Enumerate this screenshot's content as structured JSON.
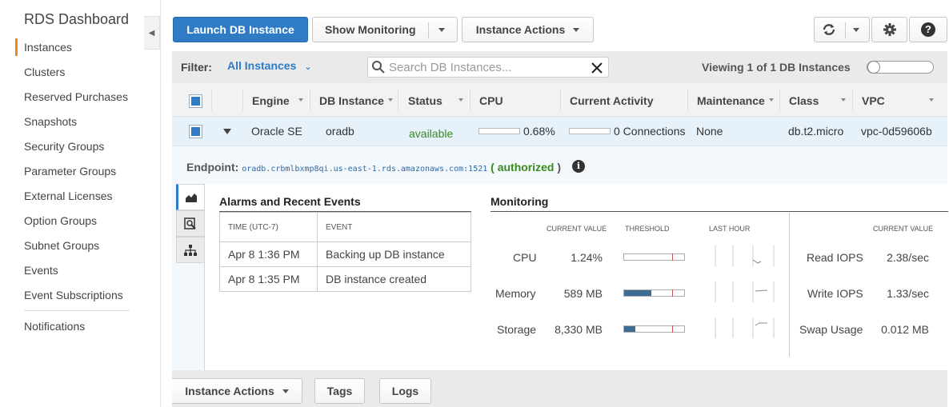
{
  "sidebar": {
    "title": "RDS Dashboard",
    "items": [
      {
        "label": "Instances"
      },
      {
        "label": "Clusters"
      },
      {
        "label": "Reserved Purchases"
      },
      {
        "label": "Snapshots"
      },
      {
        "label": "Security Groups"
      },
      {
        "label": "Parameter Groups"
      },
      {
        "label": "External Licenses"
      },
      {
        "label": "Option Groups"
      },
      {
        "label": "Subnet Groups"
      },
      {
        "label": "Events"
      },
      {
        "label": "Event Subscriptions"
      },
      {
        "label": "Notifications"
      }
    ],
    "active_index": 0
  },
  "toolbar": {
    "launch_label": "Launch DB Instance",
    "show_monitoring_label": "Show Monitoring",
    "instance_actions_label": "Instance Actions"
  },
  "filter": {
    "label": "Filter:",
    "selected": "All Instances",
    "search_placeholder": "Search DB Instances...",
    "viewing_text": "Viewing 1 of 1 DB Instances"
  },
  "table": {
    "headers": [
      "Engine",
      "DB Instance",
      "Status",
      "CPU",
      "Current Activity",
      "Maintenance",
      "Class",
      "VPC"
    ],
    "row": {
      "engine": "Oracle SE",
      "db_instance": "oradb",
      "status": "available",
      "cpu": "0.68%",
      "cpu_fraction": 0.0068,
      "activity": "0 Connections",
      "maintenance": "None",
      "class": "db.t2.micro",
      "vpc": "vpc-0d59606b"
    }
  },
  "detail": {
    "endpoint_label": "Endpoint:",
    "endpoint_url": "oradb.crbmlbxmp8qi.us-east-1.rds.amazonaws.com:1521",
    "endpoint_status_open": "(",
    "endpoint_status": "authorized",
    "endpoint_status_close": ")",
    "alarms": {
      "title": "Alarms and Recent Events",
      "col_time": "TIME (UTC-7)",
      "col_event": "EVENT",
      "rows": [
        {
          "time": "Apr 8 1:36 PM",
          "event": "Backing up DB instance"
        },
        {
          "time": "Apr 8 1:35 PM",
          "event": "DB instance created"
        }
      ]
    },
    "monitoring": {
      "title": "Monitoring",
      "col_current": "CURRENT VALUE",
      "col_threshold": "THRESHOLD",
      "col_last_hour": "LAST HOUR",
      "col_current_right": "CURRENT VALUE",
      "metrics": [
        {
          "label": "CPU",
          "value": "1.24%",
          "fill": 0.0
        },
        {
          "label": "Memory",
          "value": "589 MB",
          "fill": 0.45
        },
        {
          "label": "Storage",
          "value": "8,330 MB",
          "fill": 0.18
        }
      ],
      "right_metrics": [
        {
          "label": "Read IOPS",
          "value": "2.38/sec"
        },
        {
          "label": "Write IOPS",
          "value": "1.33/sec"
        },
        {
          "label": "Swap Usage",
          "value": "0.012 MB"
        }
      ]
    }
  },
  "bottom": {
    "instance_actions_label": "Instance Actions",
    "tags_label": "Tags",
    "logs_label": "Logs"
  }
}
